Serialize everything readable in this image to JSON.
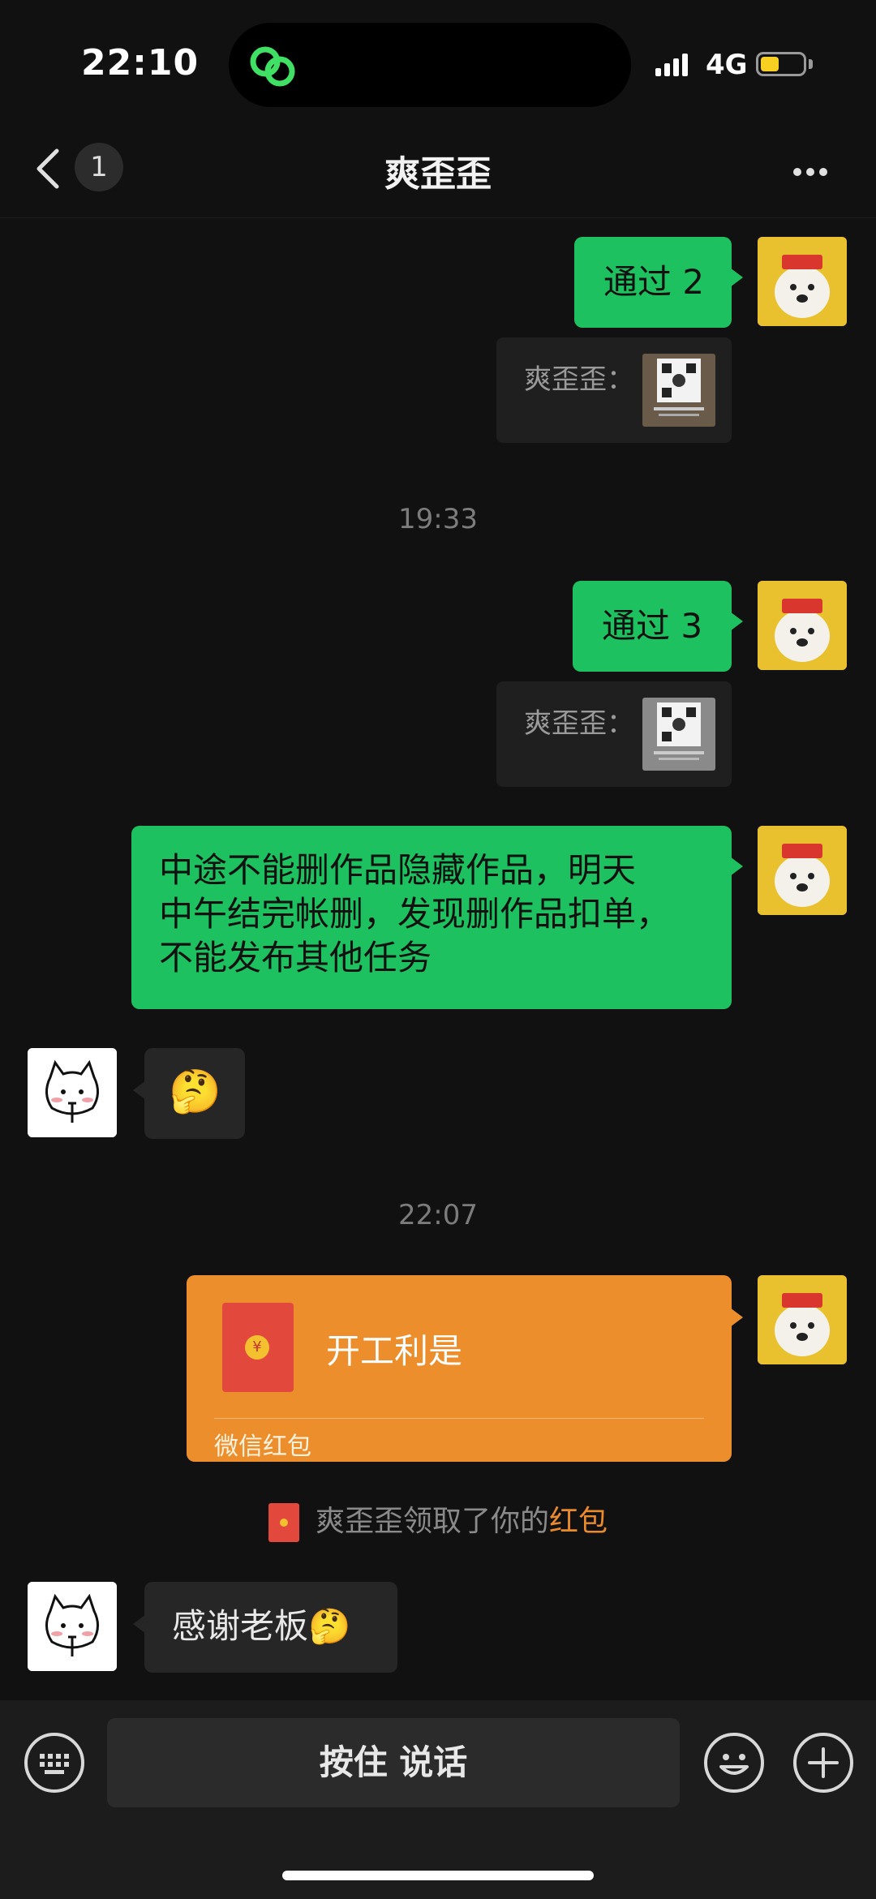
{
  "status_bar": {
    "time": "22:10",
    "network": "4G"
  },
  "nav": {
    "unread_badge": "1",
    "title": "爽歪歪"
  },
  "messages": [
    {
      "type": "outgoing_text",
      "text": "通过 2"
    },
    {
      "type": "quote",
      "label": "爽歪歪：",
      "thumb": "qr-code-image"
    },
    {
      "type": "timestamp",
      "text": "19:33"
    },
    {
      "type": "outgoing_text",
      "text": "通过 3"
    },
    {
      "type": "quote",
      "label": "爽歪歪：",
      "thumb": "qr-code-image"
    },
    {
      "type": "outgoing_text",
      "lines": [
        "中途不能删作品隐藏作品，明天",
        "中午结完帐删，发现删作品扣单，",
        "不能发布其他任务"
      ]
    },
    {
      "type": "incoming_emoji",
      "emoji": "🤔"
    },
    {
      "type": "timestamp",
      "text": "22:07"
    },
    {
      "type": "red_packet",
      "title": "开工利是",
      "footer": "微信红包"
    },
    {
      "type": "system",
      "prefix": "爽歪歪领取了你的",
      "link": "红包"
    },
    {
      "type": "incoming_text",
      "text": "感谢老板🤔"
    }
  ],
  "input_bar": {
    "voice_toggle_icon": "keyboard-icon",
    "hold_to_talk": "按住 说话",
    "emoji_icon": "emoji-icon",
    "more_icon": "plus-icon"
  },
  "colors": {
    "background": "#111111",
    "outgoing_bubble": "#1ec15f",
    "incoming_bubble": "#262626",
    "red_packet": "#ec8e2c",
    "link": "#ea8b2b"
  }
}
